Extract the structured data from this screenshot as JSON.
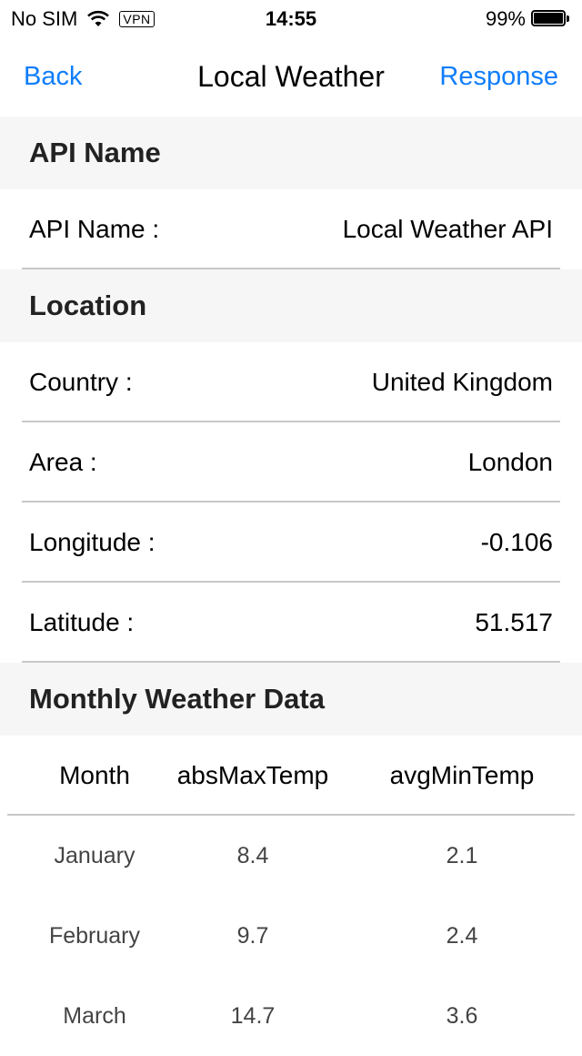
{
  "status_bar": {
    "carrier": "No SIM",
    "vpn": "VPN",
    "time": "14:55",
    "battery": "99%",
    "battery_level": 0.99
  },
  "nav": {
    "back_label": "Back",
    "title": "Local Weather",
    "response_label": "Response"
  },
  "sections": {
    "api": {
      "header": "API Name",
      "rows": [
        {
          "label": "API Name :",
          "value": "Local Weather API"
        }
      ]
    },
    "location": {
      "header": "Location",
      "rows": [
        {
          "label": "Country :",
          "value": "United Kingdom"
        },
        {
          "label": "Area :",
          "value": "London"
        },
        {
          "label": "Longitude :",
          "value": "-0.106"
        },
        {
          "label": "Latitude :",
          "value": "51.517"
        }
      ]
    },
    "monthly": {
      "header": "Monthly Weather Data",
      "columns": [
        "Month",
        "absMaxTemp",
        "avgMinTemp"
      ],
      "rows": [
        [
          "January",
          "8.4",
          "2.1"
        ],
        [
          "February",
          "9.7",
          "2.4"
        ],
        [
          "March",
          "14.7",
          "3.6"
        ]
      ]
    }
  },
  "colors": {
    "accent": "#0f7dfb",
    "section_bg": "#f6f6f6",
    "separator": "#c8c8c8"
  }
}
